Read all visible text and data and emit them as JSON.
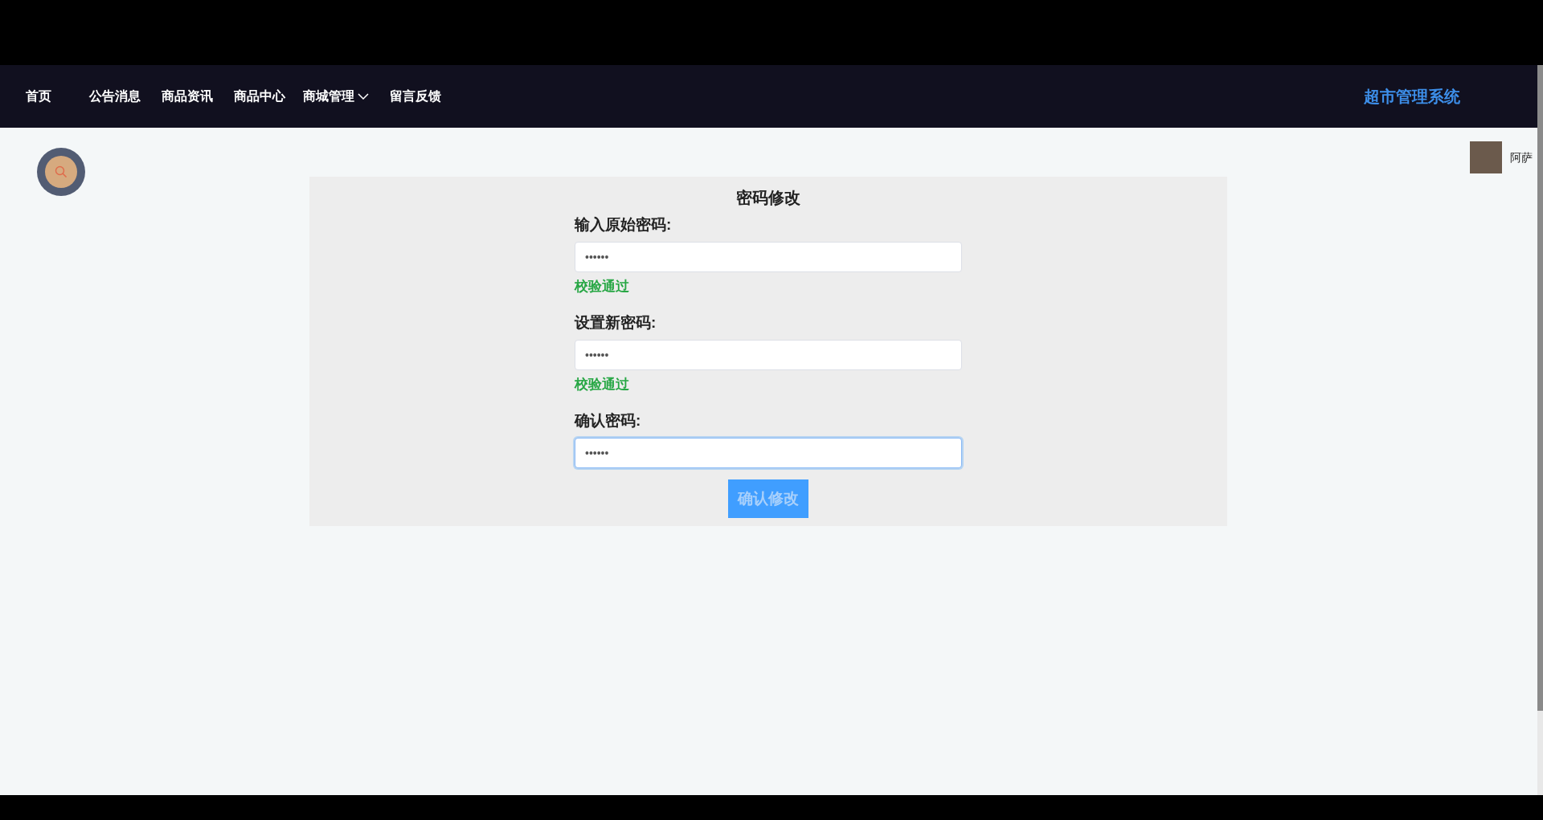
{
  "nav": {
    "items": [
      {
        "label": "首页",
        "kind": "link",
        "selected": false
      },
      {
        "label": "公告消息",
        "kind": "link",
        "selected": false
      },
      {
        "label": "商品资讯",
        "kind": "link",
        "selected": false
      },
      {
        "label": "商品中心",
        "kind": "link",
        "selected": false
      },
      {
        "label": "商城管理",
        "kind": "dropdown",
        "selected": false
      },
      {
        "label": "留言反馈",
        "kind": "link",
        "selected": false
      }
    ],
    "brand": "超市管理系统"
  },
  "user": {
    "name": "阿萨"
  },
  "form": {
    "title": "密码修改",
    "fields": [
      {
        "label": "输入原始密码:",
        "value": "••••••",
        "focused": false,
        "message": "校验通过",
        "valid": true
      },
      {
        "label": "设置新密码:",
        "value": "••••••",
        "focused": false,
        "message": "校验通过",
        "valid": true
      },
      {
        "label": "确认密码:",
        "value": "••••••",
        "focused": true
      }
    ],
    "submit": "确认修改"
  }
}
